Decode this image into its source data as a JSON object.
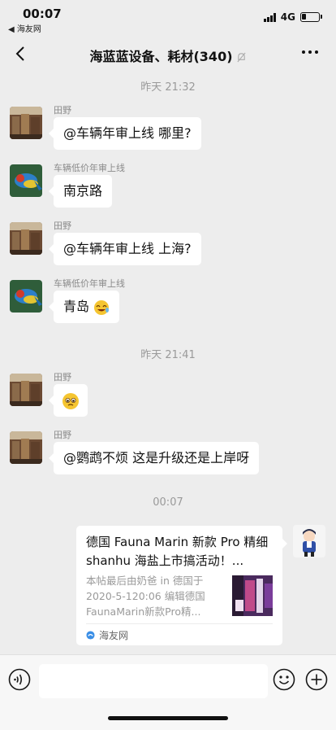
{
  "status_bar": {
    "time": "00:07",
    "back_app": "◀ 海友网",
    "network": "4G",
    "battery_level": 0.3
  },
  "nav": {
    "title": "海蓝蓝设备、耗材(340)"
  },
  "messages": {
    "ts1": "昨天 21:32",
    "m1": {
      "sender": "田野",
      "text": "@车辆年审上线 哪里?"
    },
    "m2": {
      "sender": "车辆低价年审上线",
      "text": "南京路"
    },
    "m3": {
      "sender": "田野",
      "text": "@车辆年审上线 上海?"
    },
    "m4": {
      "sender": "车辆低价年审上线",
      "text": "青岛"
    },
    "ts2": "昨天 21:41",
    "m5": {
      "sender": "田野"
    },
    "m6": {
      "sender": "田野",
      "text": "@鹦鹉不烦 这是升级还是上岸呀"
    },
    "ts3": "00:07"
  },
  "link_card": {
    "title": "德国 Fauna Marin 新款 Pro 精细 shanhu 海盐上市搞活动！...",
    "description": "本帖最后由奶爸 in 德国于 2020-5-120:06 编辑德国 FaunaMarin新款Pro精...",
    "source": "海友网"
  },
  "colors": {
    "background": "#ededed",
    "bubble": "#ffffff",
    "timestamp": "#9a9a9a"
  }
}
